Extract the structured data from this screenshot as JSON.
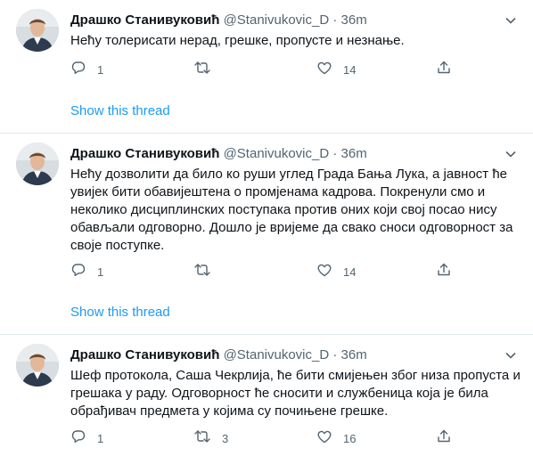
{
  "colors": {
    "name": "#0f1419",
    "secondary": "#536471",
    "link": "#1d9bf0",
    "separator": "#e1e8ed"
  },
  "tweets": [
    {
      "name": "Драшко Станивуковић",
      "handle": "@Stanivukovic_D · 36m",
      "text": "Нећу толерисати нерад, грешке, пропусте и незнање.",
      "replies": "1",
      "retweets": "",
      "likes": "14",
      "show_thread": "Show this thread"
    },
    {
      "name": "Драшко Станивуковић",
      "handle": "@Stanivukovic_D · 36m",
      "text": "Нећу дозволити да било ко руши углед Града Бања Лука, а јавност ће увијек бити обавијештена о промјенама кадрова. Покренули смо и неколико дисциплинских поступака против оних који свој посао нису обављали одговорно. Дошло је вријеме да свако сноси одговорност за своје поступке.",
      "replies": "1",
      "retweets": "",
      "likes": "14",
      "show_thread": "Show this thread"
    },
    {
      "name": "Драшко Станивуковић",
      "handle": "@Stanivukovic_D · 36m",
      "text": "Шеф протокола, Саша Чекрлија, ће бити смијењен због низа пропуста и грешака у раду. Одговорност ће сносити и службеница која је била обрађивач предмета у којима су почињене грешке.",
      "replies": "1",
      "retweets": "3",
      "likes": "16",
      "show_thread": ""
    }
  ],
  "icons": {
    "caret": "chevron-down-icon",
    "reply": "reply-icon",
    "retweet": "retweet-icon",
    "like": "heart-icon",
    "share": "share-icon"
  }
}
